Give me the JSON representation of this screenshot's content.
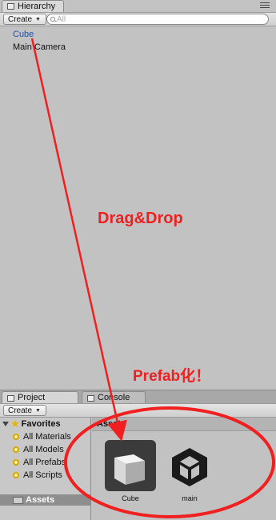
{
  "hierarchy": {
    "tab_label": "Hierarchy",
    "create_label": "Create",
    "search_placeholder": "All",
    "items": [
      {
        "label": "Cube"
      },
      {
        "label": "Main Camera"
      }
    ]
  },
  "annotations": {
    "drag_text": "Drag&Drop",
    "prefab_text": "Prefab化！",
    "color": "#f02020"
  },
  "project": {
    "tab_label": "Project",
    "console_tab_label": "Console",
    "create_label": "Create",
    "favorites": {
      "label": "Favorites",
      "items": [
        {
          "label": "All Materials"
        },
        {
          "label": "All Models"
        },
        {
          "label": "All Prefabs"
        },
        {
          "label": "All Scripts"
        }
      ]
    },
    "assets_folder_label": "Assets",
    "assets_header": "Assets",
    "assets": [
      {
        "label": "Cube",
        "icon": "cube-prefab-icon"
      },
      {
        "label": "main",
        "icon": "unity-scene-icon"
      }
    ]
  }
}
